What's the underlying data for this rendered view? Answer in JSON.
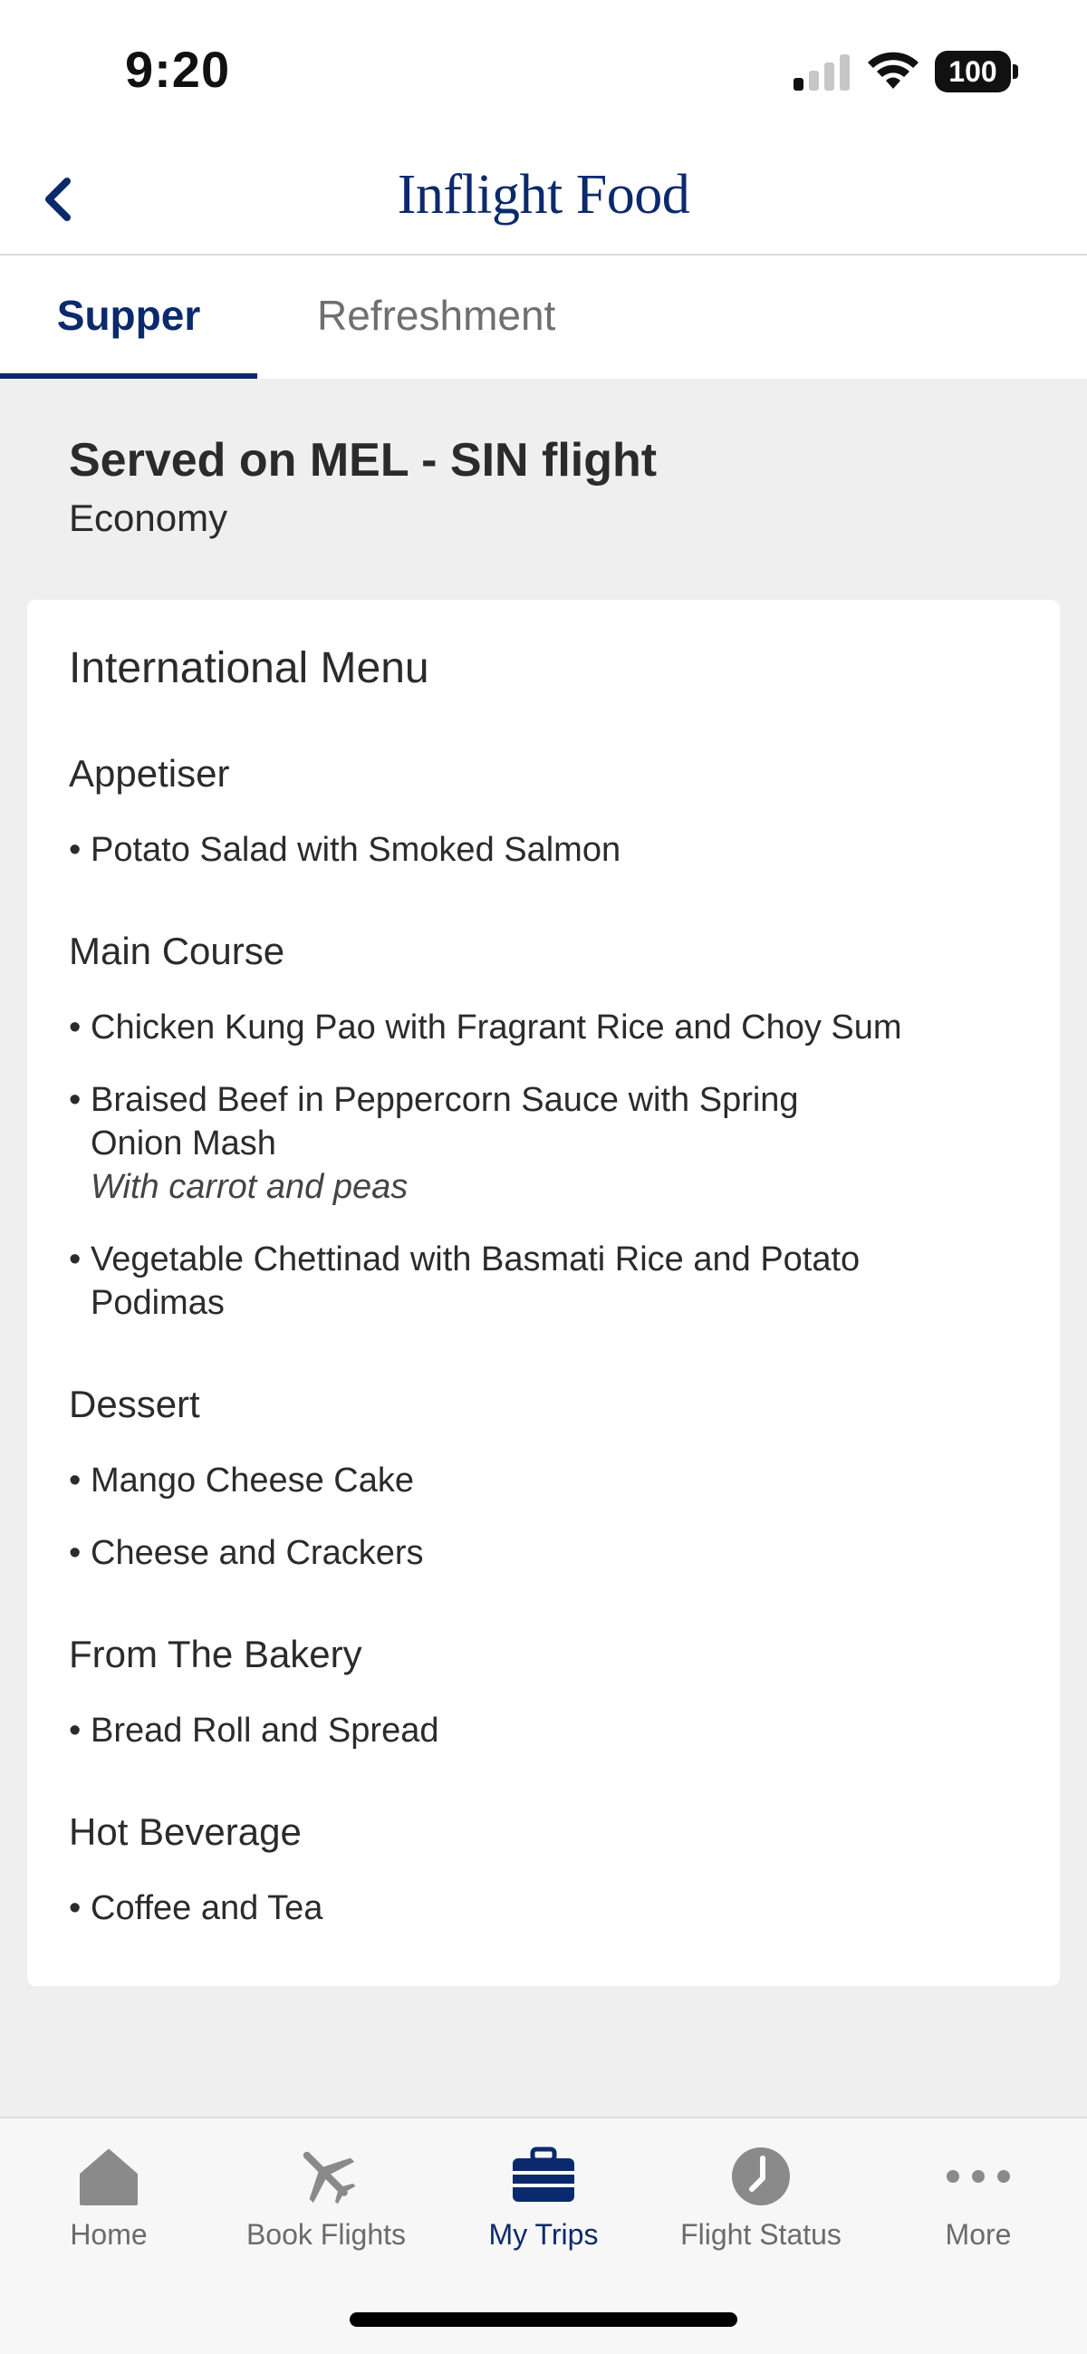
{
  "status_bar": {
    "time": "9:20",
    "battery": "100"
  },
  "header": {
    "title": "Inflight Food",
    "back_icon": "chevron-left-icon"
  },
  "tabs": [
    {
      "label": "Supper",
      "active": true
    },
    {
      "label": "Refreshment",
      "active": false
    }
  ],
  "served": {
    "title": "Served on MEL - SIN flight",
    "cabin": "Economy"
  },
  "menu": {
    "title": "International Menu",
    "sections": [
      {
        "heading": "Appetiser",
        "items": [
          {
            "lines": [
              "Potato Salad with Smoked Salmon"
            ],
            "note": ""
          }
        ]
      },
      {
        "heading": "Main Course",
        "items": [
          {
            "lines": [
              "Chicken Kung Pao with Fragrant Rice and Choy Sum"
            ],
            "note": ""
          },
          {
            "lines": [
              "Braised Beef in Peppercorn Sauce with Spring",
              "Onion Mash"
            ],
            "note": "With carrot and peas"
          },
          {
            "lines": [
              "Vegetable Chettinad with Basmati Rice and Potato",
              "Podimas"
            ],
            "note": ""
          }
        ]
      },
      {
        "heading": "Dessert",
        "items": [
          {
            "lines": [
              "Mango Cheese Cake"
            ],
            "note": ""
          },
          {
            "lines": [
              "Cheese and Crackers"
            ],
            "note": ""
          }
        ]
      },
      {
        "heading": "From The Bakery",
        "items": [
          {
            "lines": [
              "Bread Roll and Spread"
            ],
            "note": ""
          }
        ]
      },
      {
        "heading": "Hot Beverage",
        "items": [
          {
            "lines": [
              "Coffee and Tea"
            ],
            "note": ""
          }
        ]
      }
    ]
  },
  "bottom_nav": [
    {
      "label": "Home",
      "icon": "home-icon",
      "active": false
    },
    {
      "label": "Book Flights",
      "icon": "airplane-icon",
      "active": false
    },
    {
      "label": "My Trips",
      "icon": "suitcase-icon",
      "active": true
    },
    {
      "label": "Flight Status",
      "icon": "clock-icon",
      "active": false
    },
    {
      "label": "More",
      "icon": "more-dots-icon",
      "active": false
    }
  ],
  "colors": {
    "brand": "#0b2a6d",
    "inactive": "#6b6b6b",
    "background": "#efefef"
  }
}
